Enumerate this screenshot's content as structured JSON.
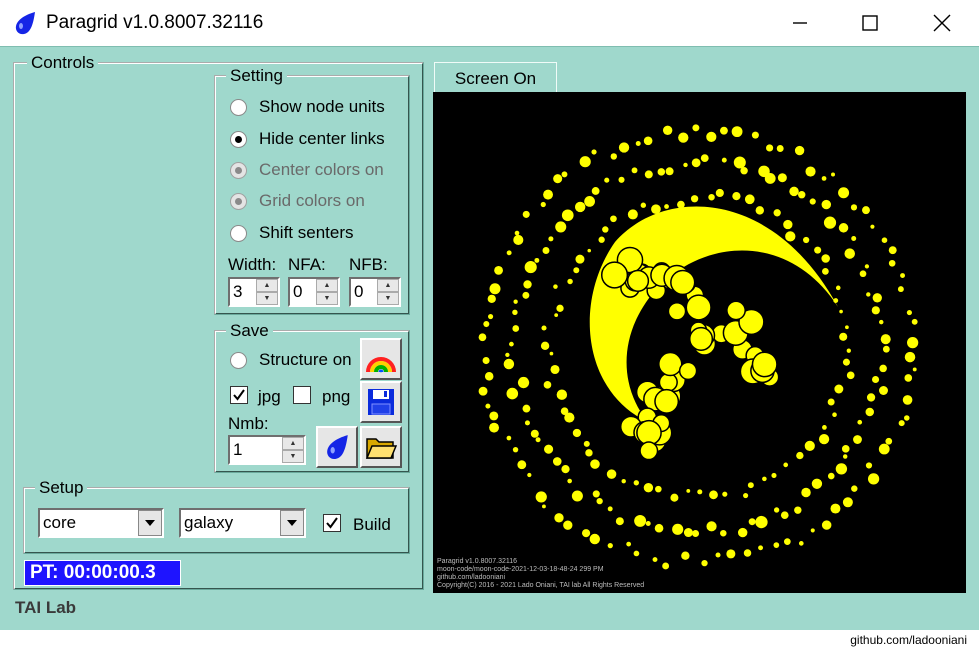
{
  "window": {
    "title": "Paragrid v1.0.8007.32116",
    "minimize_icon": "minimize-icon",
    "maximize_icon": "maximize-icon",
    "close_icon": "close-icon"
  },
  "controls": {
    "legend": "Controls",
    "setting": {
      "legend": "Setting",
      "options": [
        {
          "label": "Show node units",
          "checked": false,
          "enabled": true
        },
        {
          "label": "Hide center links",
          "checked": true,
          "enabled": true
        },
        {
          "label": "Center colors on",
          "checked": true,
          "enabled": false
        },
        {
          "label": "Grid colors on",
          "checked": true,
          "enabled": false
        },
        {
          "label": "Shift senters",
          "checked": false,
          "enabled": true
        }
      ],
      "width_label": "Width:",
      "nfa_label": "NFA:",
      "nfb_label": "NFB:",
      "width_value": "3",
      "nfa_value": "0",
      "nfb_value": "0"
    },
    "save": {
      "legend": "Save",
      "structure_label": "Structure on",
      "jpg_label": "jpg",
      "jpg_checked": true,
      "png_label": "png",
      "png_checked": false,
      "nmb_label": "Nmb:",
      "nmb_value": "1",
      "icons": [
        "rainbow-icon",
        "floppy-disk-icon",
        "blue-drop-icon",
        "folder-icon"
      ]
    },
    "setup": {
      "legend": "Setup",
      "combo1_value": "core",
      "combo2_value": "galaxy",
      "build_label": "Build",
      "build_checked": true
    },
    "pt_text": "PT: 00:00:00.3",
    "footer_text": "TAI Lab"
  },
  "screen": {
    "tab_label": "Screen On",
    "notes": [
      "Paragrid v1.0.8007.32116",
      "moon-code/moon-code-2021-12-03-18-48-24 299 PM",
      "github.com/ladooniani",
      "Copyright(C) 2016 - 2021 Lado Oniani, TAI lab All Rights Reserved"
    ]
  },
  "credit": "github.com/ladooniani",
  "colors": {
    "background": "#9fd8cc",
    "pt_box": "#1e14ff",
    "graphic": "#ffff00",
    "screen": "#000000"
  }
}
